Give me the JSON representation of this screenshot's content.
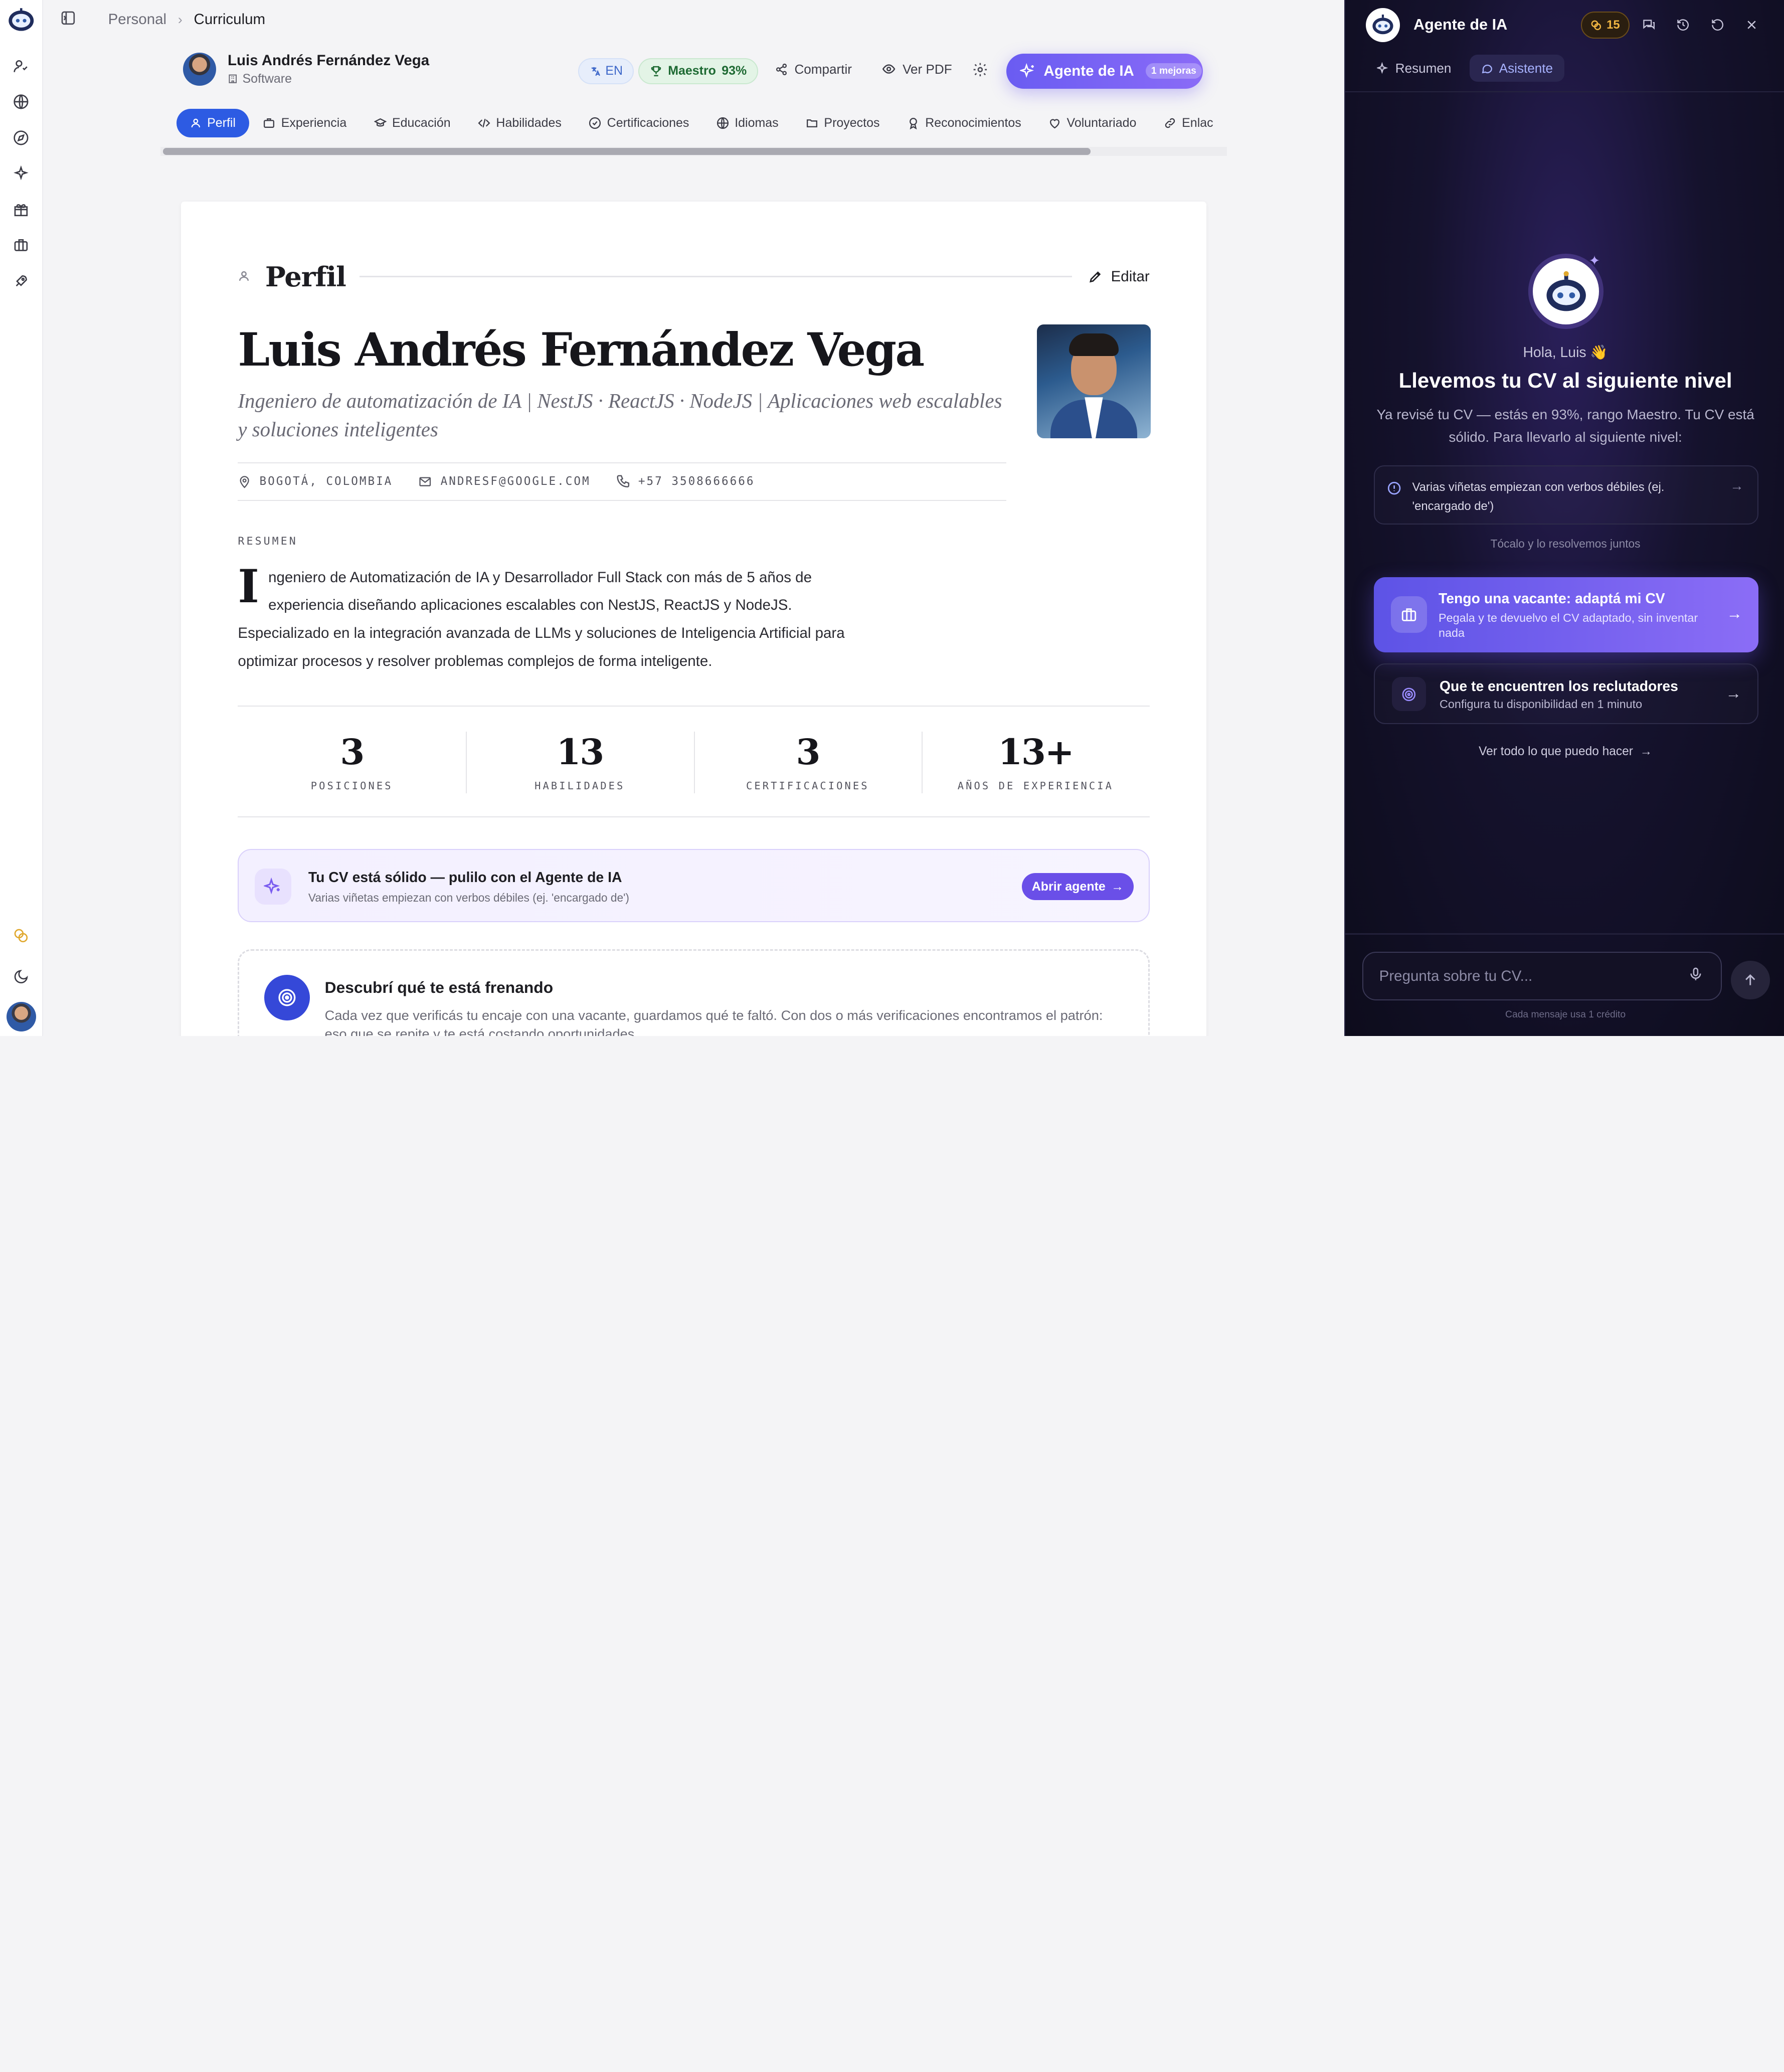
{
  "breadcrumb": {
    "root": "Personal",
    "current": "Curriculum"
  },
  "profile": {
    "name": "Luis Andrés Fernández Vega",
    "category": "Software",
    "language_chip": "EN",
    "level_label": "Maestro",
    "level_percent": "93%",
    "share_label": "Compartir",
    "pdf_label": "Ver PDF",
    "ai_button_label": "Agente de IA",
    "ai_button_badge": "1 mejoras"
  },
  "tabs": [
    {
      "label": "Perfil",
      "icon": "user-icon"
    },
    {
      "label": "Experiencia",
      "icon": "briefcase-icon"
    },
    {
      "label": "Educación",
      "icon": "graduation-icon"
    },
    {
      "label": "Habilidades",
      "icon": "code-icon"
    },
    {
      "label": "Certificaciones",
      "icon": "check-circle-icon"
    },
    {
      "label": "Idiomas",
      "icon": "globe-icon"
    },
    {
      "label": "Proyectos",
      "icon": "folder-icon"
    },
    {
      "label": "Reconocimientos",
      "icon": "award-icon"
    },
    {
      "label": "Voluntariado",
      "icon": "heart-icon"
    },
    {
      "label": "Enlac",
      "icon": "link-icon"
    }
  ],
  "section": {
    "title": "Perfil",
    "edit_label": "Editar"
  },
  "cv": {
    "full_name": "Luis Andrés Fernández Vega",
    "headline": "Ingeniero de automatización de IA | NestJS · ReactJS · NodeJS | Aplicaciones web escalables y soluciones inteligentes",
    "location": "BOGOTÁ, COLOMBIA",
    "email": "ANDRESF@GOOGLE.COM",
    "phone": "+57 3508666666",
    "summary_label": "RESUMEN",
    "summary_dropcap": "I",
    "summary_rest": "ngeniero de Automatización de IA y Desarrollador Full Stack con más de 5 años de experiencia diseñando aplicaciones escalables con NestJS, ReactJS y NodeJS. Especializado en la integración avanzada de LLMs y soluciones de Inteligencia Artificial para optimizar procesos y resolver problemas complejos de forma inteligente."
  },
  "stats": [
    {
      "value": "3",
      "label": "POSICIONES"
    },
    {
      "value": "13",
      "label": "HABILIDADES"
    },
    {
      "value": "3",
      "label": "CERTIFICACIONES"
    },
    {
      "value": "13+",
      "label": "AÑOS DE EXPERIENCIA"
    }
  ],
  "promo": {
    "title": "Tu CV está sólido — pulilo con el Agente de IA",
    "subtitle": "Varias viñetas empiezan con verbos débiles (ej. 'encargado de')",
    "button": "Abrir agente"
  },
  "discover": {
    "title": "Descubrí qué te está frenando",
    "text": "Cada vez que verificás tu encaje con una vacante, guardamos qué te faltó. Con dos o más verificaciones encontramos el patrón: eso que se repite y te está costando oportunidades."
  },
  "ai_panel": {
    "title": "Agente de IA",
    "credits": "15",
    "tabs": [
      "Resumen",
      "Asistente"
    ],
    "greeting": "Hola, Luis 👋",
    "heading": "Llevemos tu CV al siguiente nivel",
    "intro": "Ya revisé tu CV — estás en 93%, rango Maestro. Tu CV está sólido. Para llevarlo al siguiente nivel:",
    "issue": "Varias viñetas empiezan con verbos débiles (ej. 'encargado de')",
    "issue_hint": "Tócalo y lo resolvemos juntos",
    "vacancy_title": "Tengo una vacante: adaptá mi CV",
    "vacancy_sub": "Pegala y te devuelvo el CV adaptado, sin inventar nada",
    "recruiters_title": "Que te encuentren los reclutadores",
    "recruiters_sub": "Configura tu disponibilidad en 1 minuto",
    "see_all": "Ver todo lo que puedo hacer",
    "input_placeholder": "Pregunta sobre tu CV...",
    "credit_note": "Cada mensaje usa 1 crédito"
  },
  "colors": {
    "accent_blue": "#2d5be3",
    "ai_purple": "#6a5cf2",
    "level_green": "#1e6a33",
    "panel_dark": "#15122d",
    "credit_gold": "#f0b542"
  }
}
